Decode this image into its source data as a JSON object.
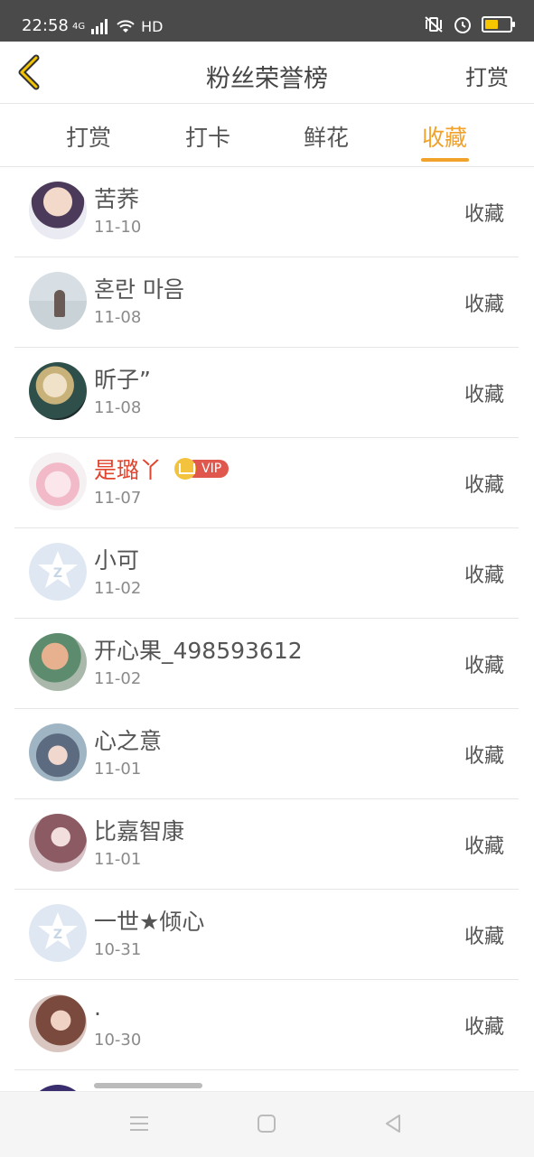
{
  "status_bar": {
    "time": "22:58",
    "network": "4G",
    "hd": "HD",
    "battery_level": 0.55,
    "colors": {
      "background": "#4a4a4a",
      "battery_fill": "#f7c600"
    }
  },
  "header": {
    "title": "粉丝荣誉榜",
    "back_icon": "chevron-left-icon",
    "right_action": "打赏",
    "accent": "#f1a22a"
  },
  "tabs": [
    {
      "label": "打赏",
      "active": false
    },
    {
      "label": "打卡",
      "active": false
    },
    {
      "label": "鲜花",
      "active": false
    },
    {
      "label": "收藏",
      "active": true
    }
  ],
  "list": [
    {
      "name": "苦荞",
      "date": "11-10",
      "action": "收藏",
      "vip": false,
      "avatar": "photo-girl-icon"
    },
    {
      "name": "혼란 마음",
      "date": "11-08",
      "action": "收藏",
      "vip": false,
      "avatar": "photo-beach-icon"
    },
    {
      "name": "昕子”",
      "date": "11-08",
      "action": "收藏",
      "vip": false,
      "avatar": "photo-portrait-icon"
    },
    {
      "name": "是璐丫",
      "date": "11-07",
      "action": "收藏",
      "vip": true,
      "vip_label": "VIP",
      "avatar": "anime-pink-icon"
    },
    {
      "name": "小可",
      "date": "11-02",
      "action": "收藏",
      "vip": false,
      "avatar": "default-avatar-icon"
    },
    {
      "name": "开心果_498593612",
      "date": "11-02",
      "action": "收藏",
      "vip": false,
      "avatar": "photo-child-icon"
    },
    {
      "name": "心之意",
      "date": "11-01",
      "action": "收藏",
      "vip": false,
      "avatar": "anime-girl-icon"
    },
    {
      "name": "比嘉智康",
      "date": "11-01",
      "action": "收藏",
      "vip": false,
      "avatar": "anime-hair-icon"
    },
    {
      "name": "一世★倾心",
      "date": "10-31",
      "action": "收藏",
      "vip": false,
      "avatar": "default-avatar-icon"
    },
    {
      "name": ".",
      "date": "10-30",
      "action": "收藏",
      "vip": false,
      "avatar": "photo-woman-icon"
    }
  ],
  "navbar": {
    "menu_icon": "menu-icon",
    "home_icon": "home-square-icon",
    "back_icon": "back-triangle-icon"
  }
}
